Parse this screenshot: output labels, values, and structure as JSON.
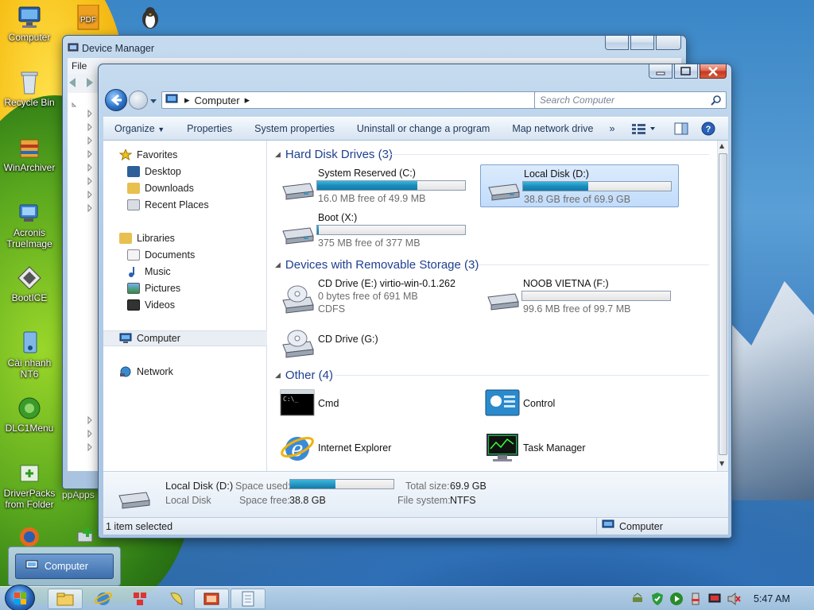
{
  "desktop": {
    "icons": [
      {
        "label": "Computer"
      },
      {
        "label": "Recycle Bin"
      },
      {
        "label": "WinArchiver"
      },
      {
        "label": "Acronis TrueImage"
      },
      {
        "label": "BootICE"
      },
      {
        "label": "Cài nhanh NT6"
      },
      {
        "label": "DLC1Menu"
      },
      {
        "label": "DriverPacks from Folder"
      }
    ],
    "top_icon_pdf_label": "PDF",
    "partial_label": "ppApps",
    "popup_label": "Computer"
  },
  "device_manager": {
    "title": "Device Manager",
    "menu_file": "File"
  },
  "explorer": {
    "address": {
      "crumb": "Computer"
    },
    "search_placeholder": "Search Computer",
    "toolbar": {
      "organize": "Organize",
      "properties": "Properties",
      "system_properties": "System properties",
      "uninstall": "Uninstall or change a program",
      "map_drive": "Map network drive",
      "more": "»"
    },
    "nav": {
      "favorites": "Favorites",
      "desktop": "Desktop",
      "downloads": "Downloads",
      "recent": "Recent Places",
      "libraries": "Libraries",
      "documents": "Documents",
      "music": "Music",
      "pictures": "Pictures",
      "videos": "Videos",
      "computer": "Computer",
      "network": "Network"
    },
    "groups": {
      "hdd": "Hard Disk Drives (3)",
      "removable": "Devices with Removable Storage (3)",
      "other": "Other (4)"
    },
    "drives": {
      "c": {
        "name": "System Reserved (C:)",
        "free": "16.0 MB free of 49.9 MB",
        "used_fraction": 0.68
      },
      "d": {
        "name": "Local Disk (D:)",
        "free": "38.8 GB free of 69.9 GB",
        "used_fraction": 0.44
      },
      "x": {
        "name": "Boot (X:)",
        "free": "375 MB free of 377 MB",
        "used_fraction": 0.01
      },
      "e": {
        "name": "CD Drive (E:) virtio-win-0.1.262",
        "free": "0 bytes free of 691 MB",
        "fs": "CDFS"
      },
      "f": {
        "name": "NOOB VIETNA (F:)",
        "free": "99.6 MB free of 99.7 MB",
        "used_fraction": 0.0
      },
      "g": {
        "name": "CD Drive (G:)"
      }
    },
    "other": {
      "cmd": "Cmd",
      "control": "Control",
      "ie": "Internet Explorer",
      "taskmgr": "Task Manager"
    },
    "details": {
      "name": "Local Disk (D:)",
      "type": "Local Disk",
      "space_used_label": "Space used:",
      "space_used_fraction": 0.44,
      "space_free_label": "Space free:",
      "space_free": "38.8 GB",
      "total_size_label": "Total size:",
      "total_size": "69.9 GB",
      "fs_label": "File system:",
      "fs": "NTFS"
    },
    "status": {
      "selected": "1 item selected",
      "location": "Computer"
    }
  },
  "taskbar": {
    "clock": "5:47 AM"
  }
}
